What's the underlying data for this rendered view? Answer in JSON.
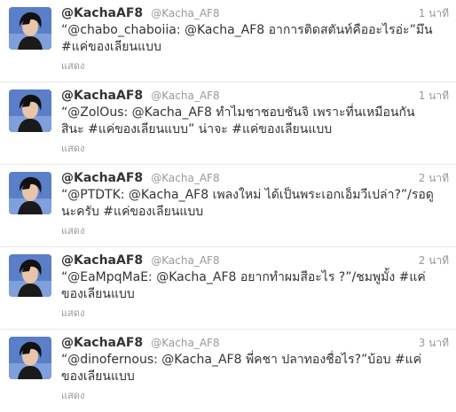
{
  "colors": {
    "text": "#333333",
    "muted": "#999999",
    "divider": "#e8e8e8",
    "avatar_bg": "#5a7fc8"
  },
  "tweets": [
    {
      "fullname": "@KachaAF8",
      "username": "@Kacha_AF8",
      "time": "1 นาที",
      "text": "“@chabo_chaboiia: @Kacha_AF8 อาการติดสตันท์คืออะไรอ่ะ”มึน #แค่ของเลียนแบบ",
      "expand": "แสดง",
      "avatar_icon": "user-avatar"
    },
    {
      "fullname": "@KachaAF8",
      "username": "@Kacha_AF8",
      "time": "1 นาที",
      "text": "“@ZolOus: @Kacha_AF8 ทำไมชาชอบชันจิ เพราะที่นเหมือนกันสินะ #แค่ของเลียนแบบ” น่าจะ #แค่ของเลียนแบบ",
      "expand": "แสดง",
      "avatar_icon": "user-avatar"
    },
    {
      "fullname": "@KachaAF8",
      "username": "@Kacha_AF8",
      "time": "2 นาที",
      "text": "“@PTDTK: @Kacha_AF8 เพลงใหม่ ได้เป็นพระเอกเอ็มวีเปล่า?”/รอดูนะครับ #แค่ของเลียนแบบ",
      "expand": "แสดง",
      "avatar_icon": "user-avatar"
    },
    {
      "fullname": "@KachaAF8",
      "username": "@Kacha_AF8",
      "time": "2 นาที",
      "text": "“@EaMpqMaE: @Kacha_AF8 อยากทำผมสีอะไร ?”/ชมพูมั้ง #แค่ของเลียนแบบ",
      "expand": "แสดง",
      "avatar_icon": "user-avatar"
    },
    {
      "fullname": "@KachaAF8",
      "username": "@Kacha_AF8",
      "time": "3 นาที",
      "text": "“@dinofernous: @Kacha_AF8 พี่คชา ปลาทองชื่อไร?”บ้อบ #แค่ของเลียนแบบ",
      "expand": "แสดง",
      "avatar_icon": "user-avatar"
    }
  ]
}
